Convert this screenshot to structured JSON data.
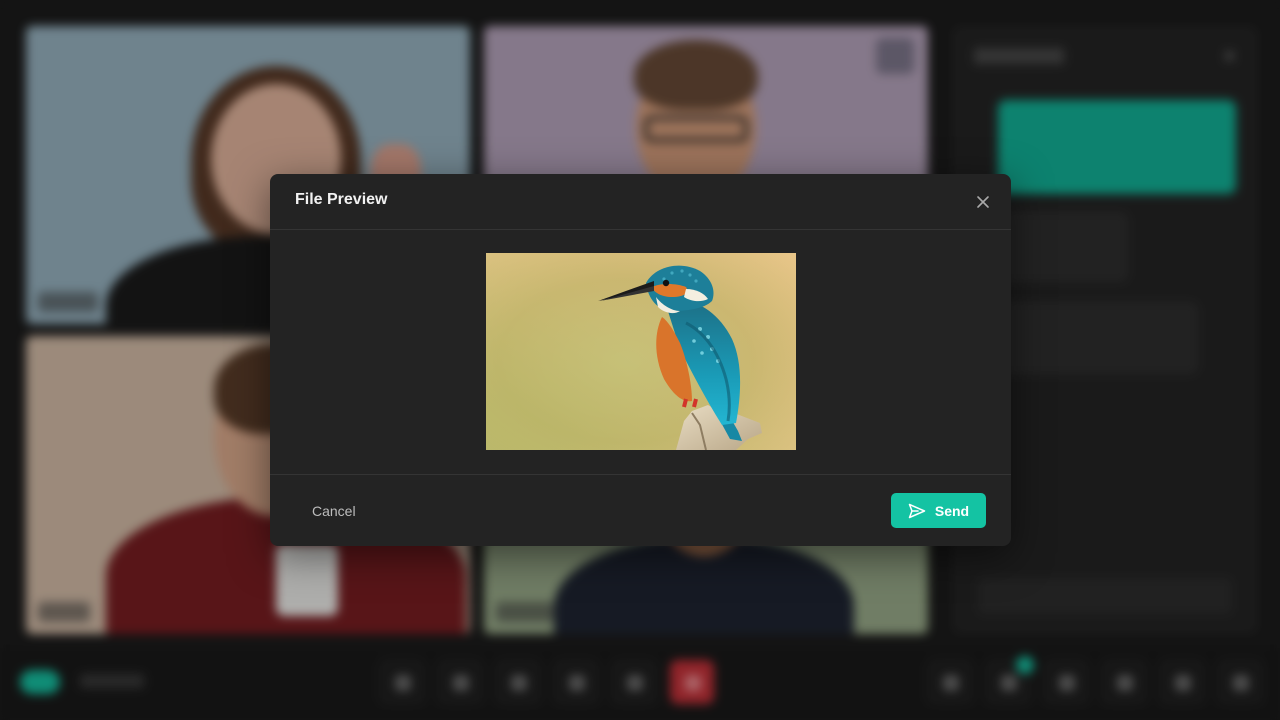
{
  "modal": {
    "title": "File Preview",
    "cancel_label": "Cancel",
    "send_label": "Send",
    "send_icon": "send-icon",
    "close_icon": "close-icon",
    "preview_icon": "kingfisher-image"
  },
  "colors": {
    "accent": "#14c3a3",
    "modal_bg": "#232323",
    "end_call": "#c8323a"
  }
}
